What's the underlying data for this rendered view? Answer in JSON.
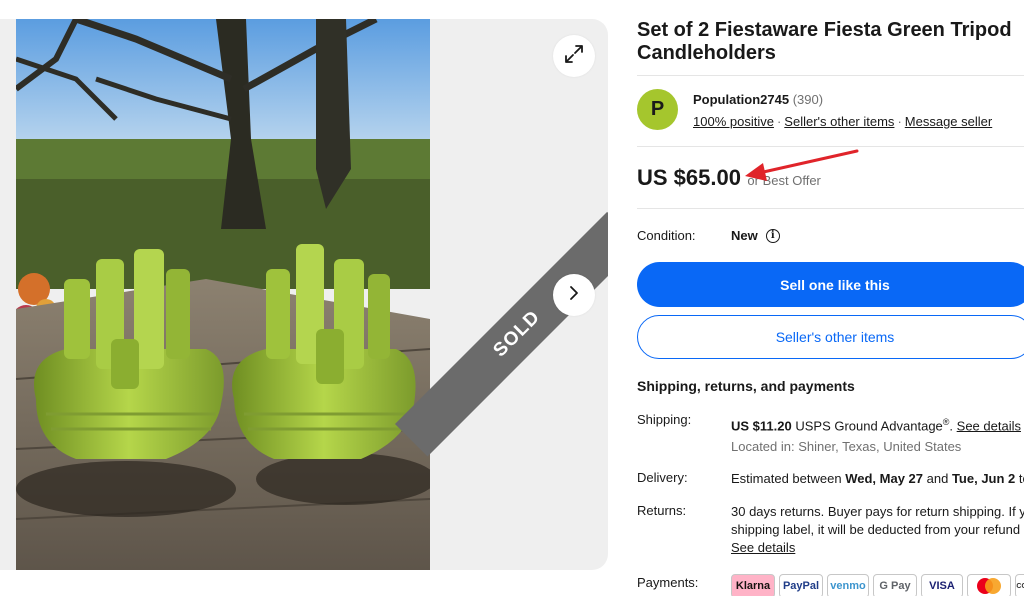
{
  "listing": {
    "title": "Set of 2 Fiestaware Fiesta Green Tripod Candleholders",
    "sold_label": "SOLD"
  },
  "seller": {
    "avatar_letter": "P",
    "name": "Population2745",
    "feedback_count": "(390)",
    "positive": "100% positive",
    "other_items": "Seller's other items",
    "message": "Message seller",
    "separator": "·"
  },
  "price": {
    "amount": "US $65.00",
    "best_offer": "or Best Offer"
  },
  "condition": {
    "label": "Condition:",
    "value": "New"
  },
  "buttons": {
    "sell_like_this": "Sell one like this",
    "sellers_other_items": "Seller's other items"
  },
  "shipping_section": {
    "heading": "Shipping, returns, and payments",
    "shipping_label": "Shipping:",
    "shipping_price": "US $11.20",
    "shipping_service": "USPS Ground Advantage",
    "shipping_reg": "®",
    "see_details": "See details",
    "location": "Located in: Shiner, Texas, United States",
    "delivery_label": "Delivery:",
    "delivery_prefix": "Estimated between",
    "delivery_start": "Wed, May 27",
    "delivery_and": "and",
    "delivery_end": "Tue, Jun 2",
    "delivery_suffix": "to",
    "returns_label": "Returns:",
    "returns_line1": "30 days returns. Buyer pays for return shipping. If y",
    "returns_line2": "shipping label, it will be deducted from your refund",
    "returns_details": "See details",
    "payments_label": "Payments:"
  },
  "payment_methods": [
    {
      "name": "Klarna",
      "bg": "#ffb3c7",
      "color": "#17120f"
    },
    {
      "name": "PayPal",
      "bg": "#ffffff",
      "color": "#1f3c88"
    },
    {
      "name": "venmo",
      "bg": "#ffffff",
      "color": "#3d95ce"
    },
    {
      "name": "G Pay",
      "bg": "#ffffff",
      "color": "#5f6368"
    },
    {
      "name": "VISA",
      "bg": "#ffffff",
      "color": "#1a1f71"
    },
    {
      "name": "mastercard",
      "bg": "#ffffff",
      "color": "#eb001b"
    },
    {
      "name": "DISCOVER",
      "bg": "#ffffff",
      "color": "#333333"
    }
  ],
  "colors": {
    "primary_blue": "#0968f6",
    "avatar_green": "#a5c62d",
    "annotation_arrow": "#e0242a"
  }
}
